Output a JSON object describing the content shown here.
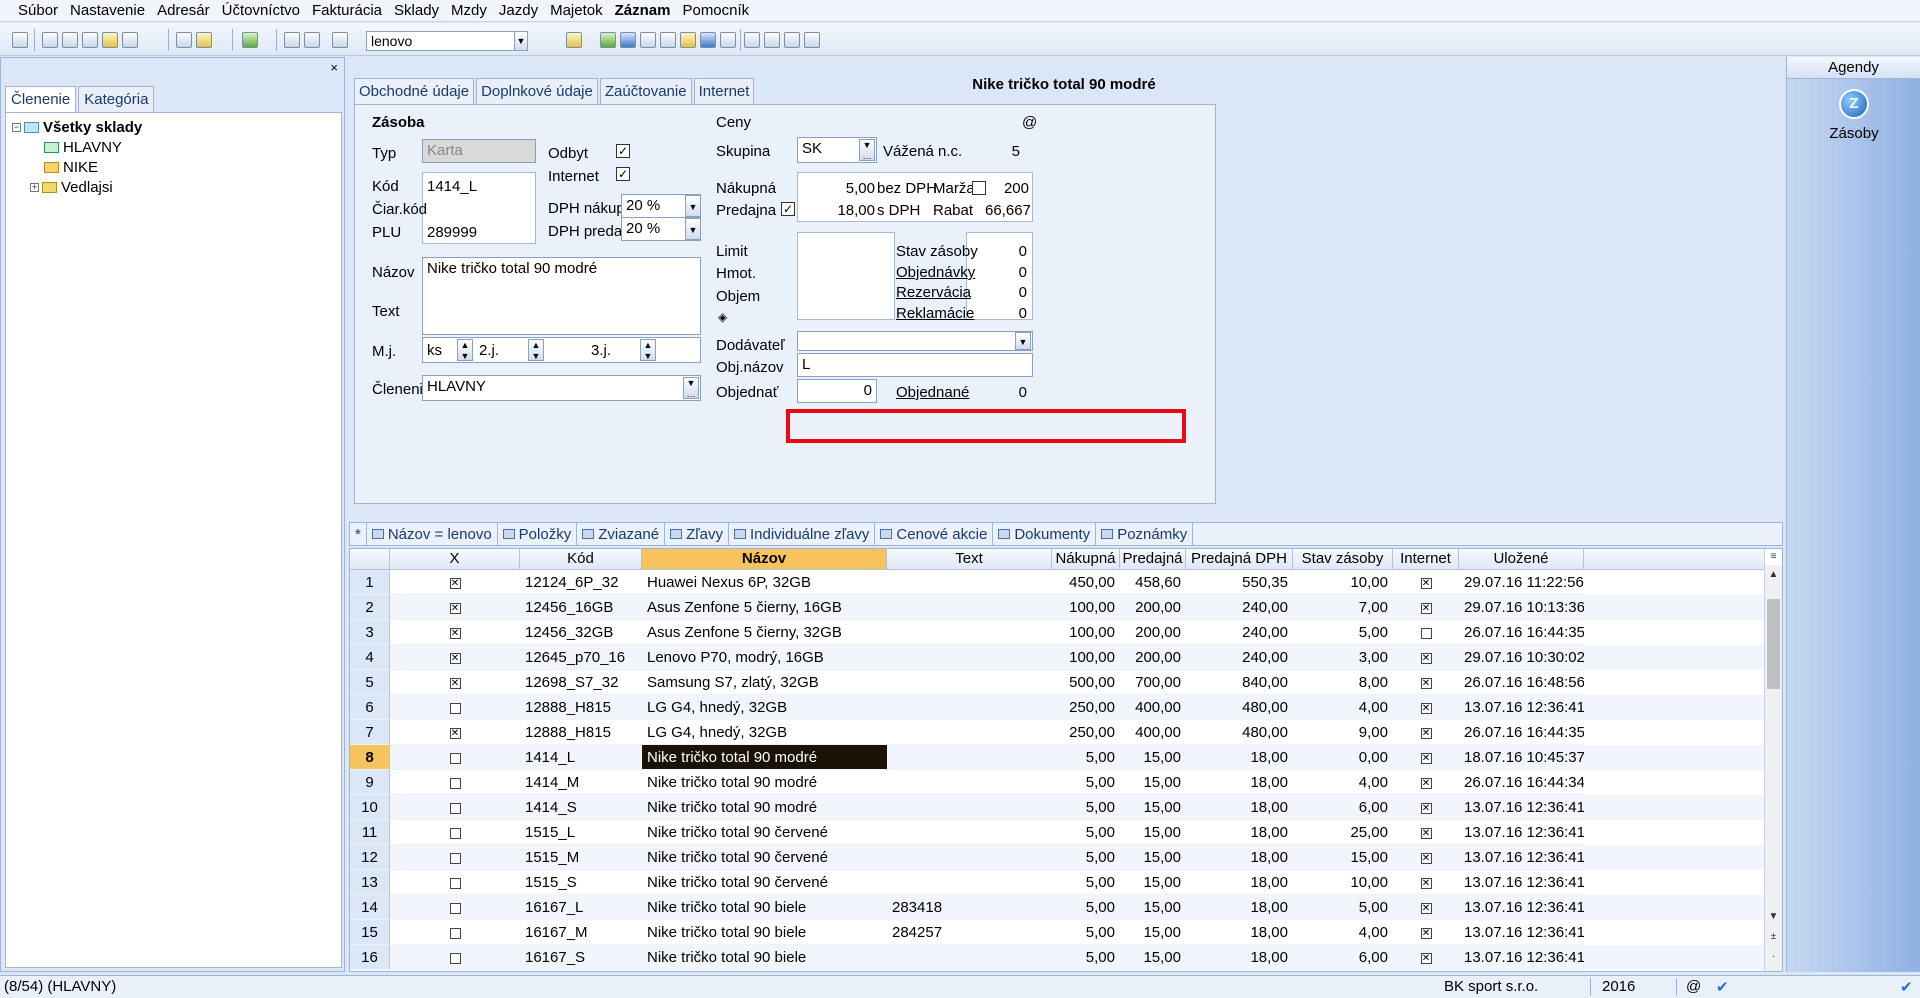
{
  "menu": [
    {
      "label": "Súbor"
    },
    {
      "label": "Nastavenie"
    },
    {
      "label": "Adresár"
    },
    {
      "label": "Účtovníctvo"
    },
    {
      "label": "Fakturácia"
    },
    {
      "label": "Sklady"
    },
    {
      "label": "Mzdy"
    },
    {
      "label": "Jazdy"
    },
    {
      "label": "Majetok"
    },
    {
      "label": "Záznam",
      "bold": true
    },
    {
      "label": "Pomocník"
    }
  ],
  "toolbar": {
    "search_value": "lenovo"
  },
  "left_panel": {
    "close": "×",
    "tabs": [
      "Členenie",
      "Kategória"
    ],
    "tree": {
      "root": "Všetky sklady",
      "children": [
        "HLAVNY",
        "NIKE",
        "Vedlajsi"
      ]
    }
  },
  "agendy": {
    "title": "Agendy",
    "item": "Zásoby",
    "icon_glyph": "Z"
  },
  "form": {
    "tabs": [
      "Obchodné údaje",
      "Doplnkové údaje",
      "Zaúčtovanie",
      "Internet"
    ],
    "title": "Nike tričko total 90 modré",
    "zasoba": {
      "section": "Zásoba",
      "typ_label": "Typ",
      "typ_value": "Karta",
      "odbyt_label": "Odbyt",
      "internet_label": "Internet",
      "kod_label": "Kód",
      "kod_value": "1414_L",
      "ciarkod_label": "Čiar.kód",
      "plu_label": "PLU",
      "plu_value": "289999",
      "dph_nakup_label": "DPH nákup",
      "dph_nakup_value": "20 %",
      "dph_predaj_label": "DPH predaj",
      "dph_predaj_value": "20 %",
      "nazov_label": "Názov",
      "nazov_value": "Nike tričko total 90 modré",
      "text_label": "Text",
      "mj_label": "M.j.",
      "mj_value": "ks",
      "mj2_label": "2.j.",
      "mj3_label": "3.j.",
      "clenenie_label": "Členenie",
      "clenenie_value": "HLAVNY"
    },
    "ceny": {
      "section": "Ceny",
      "at": "@",
      "skupina_label": "Skupina",
      "skupina_value": "SK",
      "vazena_label": "Vážená n.c.",
      "vazena_value": "5",
      "nakupna_label": "Nákupná",
      "nakupna_value": "5,00",
      "bez_dph": "bez DPH",
      "marza_label": "Marža",
      "marza_value": "200",
      "predajna_label": "Predajna",
      "predajna_value": "18,00",
      "s_dph": "s DPH",
      "rabat_label": "Rabat",
      "rabat_value": "66,667",
      "limit_label": "Limit",
      "hmot_label": "Hmot.",
      "objem_label": "Objem",
      "stav_label": "Stav zásoby",
      "stav_value": "0",
      "objednavky_label": "Objednávky",
      "objednavky_value": "0",
      "rezervacia_label": "Rezervácia",
      "rezervacia_value": "0",
      "reklamacie_label": "Reklamácie",
      "reklamacie_value": "0",
      "dodavatel_label": "Dodávateľ",
      "objnazov_label": "Obj.názov",
      "objnazov_value": "L",
      "objednat_label": "Objednať",
      "objednat_value": "0",
      "objednane_label": "Objednané",
      "objednane_value": "0"
    }
  },
  "grid_toolbar": [
    "*",
    "Názov = lenovo",
    "Položky",
    "Zviazané",
    "Zľavy",
    "Individuálne zľavy",
    "Cenové akcie",
    "Dokumenty",
    "Poznámky"
  ],
  "grid": {
    "columns": [
      "X",
      "Kód",
      "Názov",
      "Text",
      "Nákupná",
      "Predajná",
      "Predajná DPH",
      "Stav zásoby",
      "Internet",
      "Uložené"
    ],
    "rows": [
      {
        "n": "1",
        "x": true,
        "kod": "12124_6P_32",
        "nazov": "Huawei Nexus 6P, 32GB",
        "text": "",
        "nak": "450,00",
        "pred": "458,60",
        "pdph": "550,35",
        "stav": "10,00",
        "inet": true,
        "ulozene": "29.07.16 11:22:56"
      },
      {
        "n": "2",
        "x": true,
        "kod": "12456_16GB",
        "nazov": "Asus Zenfone 5 čierny, 16GB",
        "text": "",
        "nak": "100,00",
        "pred": "200,00",
        "pdph": "240,00",
        "stav": "7,00",
        "inet": true,
        "ulozene": "29.07.16 10:13:36"
      },
      {
        "n": "3",
        "x": true,
        "kod": "12456_32GB",
        "nazov": "Asus Zenfone 5 čierny, 32GB",
        "text": "",
        "nak": "100,00",
        "pred": "200,00",
        "pdph": "240,00",
        "stav": "5,00",
        "inet": false,
        "ulozene": "26.07.16 16:44:35"
      },
      {
        "n": "4",
        "x": true,
        "kod": "12645_p70_16",
        "nazov": "Lenovo P70, modrý, 16GB",
        "text": "",
        "nak": "100,00",
        "pred": "200,00",
        "pdph": "240,00",
        "stav": "3,00",
        "inet": true,
        "ulozene": "29.07.16 10:30:02"
      },
      {
        "n": "5",
        "x": true,
        "kod": "12698_S7_32",
        "nazov": "Samsung S7, zlatý, 32GB",
        "text": "",
        "nak": "500,00",
        "pred": "700,00",
        "pdph": "840,00",
        "stav": "8,00",
        "inet": true,
        "ulozene": "26.07.16 16:48:56"
      },
      {
        "n": "6",
        "x": false,
        "kod": "12888_H815",
        "nazov": "LG G4, hnedý, 32GB",
        "text": "",
        "nak": "250,00",
        "pred": "400,00",
        "pdph": "480,00",
        "stav": "4,00",
        "inet": true,
        "ulozene": "13.07.16 12:36:41"
      },
      {
        "n": "7",
        "x": true,
        "kod": "12888_H815",
        "nazov": "LG G4, hnedý, 32GB",
        "text": "",
        "nak": "250,00",
        "pred": "400,00",
        "pdph": "480,00",
        "stav": "9,00",
        "inet": true,
        "ulozene": "26.07.16 16:44:35"
      },
      {
        "n": "8",
        "x": false,
        "kod": "1414_L",
        "nazov": "Nike tričko total 90 modré",
        "text": "",
        "nak": "5,00",
        "pred": "15,00",
        "pdph": "18,00",
        "stav": "0,00",
        "inet": true,
        "ulozene": "18.07.16 10:45:37",
        "active": true
      },
      {
        "n": "9",
        "x": false,
        "kod": "1414_M",
        "nazov": "Nike tričko total 90 modré",
        "text": "",
        "nak": "5,00",
        "pred": "15,00",
        "pdph": "18,00",
        "stav": "4,00",
        "inet": true,
        "ulozene": "26.07.16 16:44:34"
      },
      {
        "n": "10",
        "x": false,
        "kod": "1414_S",
        "nazov": "Nike tričko total 90 modré",
        "text": "",
        "nak": "5,00",
        "pred": "15,00",
        "pdph": "18,00",
        "stav": "6,00",
        "inet": true,
        "ulozene": "13.07.16 12:36:41"
      },
      {
        "n": "11",
        "x": false,
        "kod": "1515_L",
        "nazov": "Nike tričko total 90 červené",
        "text": "",
        "nak": "5,00",
        "pred": "15,00",
        "pdph": "18,00",
        "stav": "25,00",
        "inet": true,
        "ulozene": "13.07.16 12:36:41"
      },
      {
        "n": "12",
        "x": false,
        "kod": "1515_M",
        "nazov": "Nike tričko total 90 červené",
        "text": "",
        "nak": "5,00",
        "pred": "15,00",
        "pdph": "18,00",
        "stav": "15,00",
        "inet": true,
        "ulozene": "13.07.16 12:36:41"
      },
      {
        "n": "13",
        "x": false,
        "kod": "1515_S",
        "nazov": "Nike tričko total 90 červené",
        "text": "",
        "nak": "5,00",
        "pred": "15,00",
        "pdph": "18,00",
        "stav": "10,00",
        "inet": true,
        "ulozene": "13.07.16 12:36:41"
      },
      {
        "n": "14",
        "x": false,
        "kod": "16167_L",
        "nazov": "Nike tričko total 90 biele",
        "text": "283418",
        "nak": "5,00",
        "pred": "15,00",
        "pdph": "18,00",
        "stav": "5,00",
        "inet": true,
        "ulozene": "13.07.16 12:36:41"
      },
      {
        "n": "15",
        "x": false,
        "kod": "16167_M",
        "nazov": "Nike tričko total 90 biele",
        "text": "284257",
        "nak": "5,00",
        "pred": "15,00",
        "pdph": "18,00",
        "stav": "4,00",
        "inet": true,
        "ulozene": "13.07.16 12:36:41"
      },
      {
        "n": "16",
        "x": false,
        "kod": "16167_S",
        "nazov": "Nike tričko total 90 biele",
        "text": "",
        "nak": "5,00",
        "pred": "15,00",
        "pdph": "18,00",
        "stav": "6,00",
        "inet": true,
        "ulozene": "13.07.16 12:36:41"
      }
    ]
  },
  "status": {
    "records": "(8/54) (HLAVNY)",
    "company": "BK sport  s.r.o.",
    "year": "2016",
    "at": "@"
  },
  "colors": {
    "highlight": "#e80a12",
    "sorted_header": "#f7c35e",
    "selected_cell": "#1a1206"
  }
}
